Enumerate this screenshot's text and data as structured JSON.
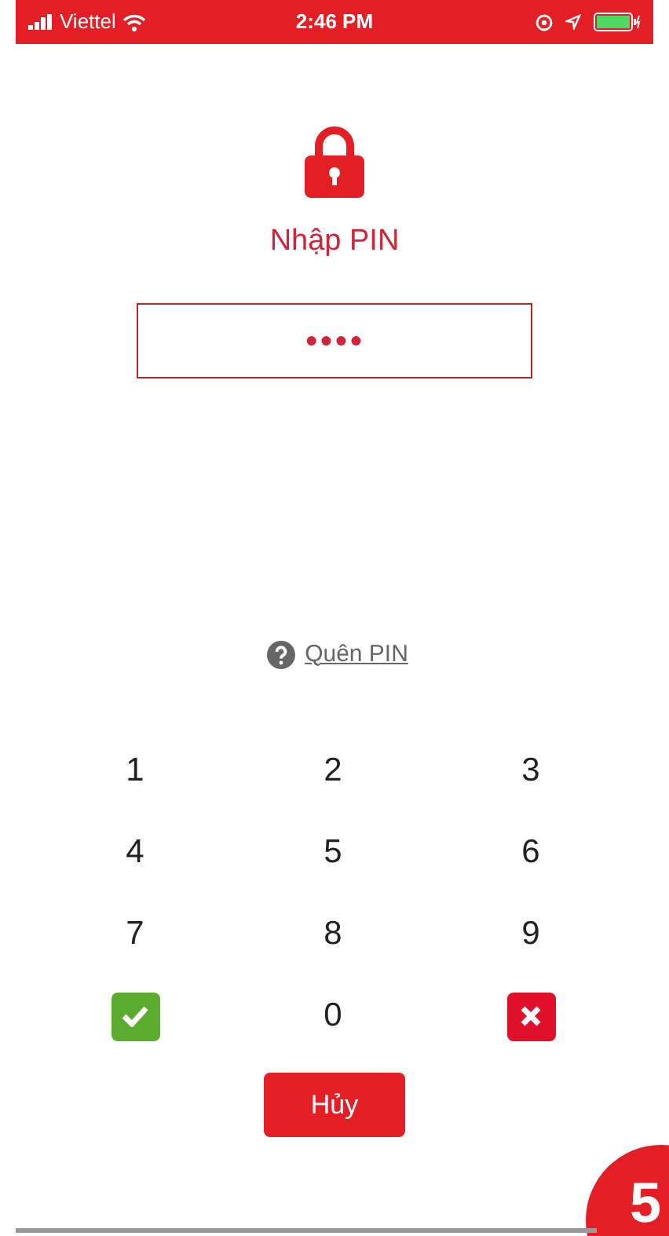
{
  "status_bar": {
    "carrier": "Viettel",
    "time": "2:46 PM"
  },
  "title": "Nhập PIN",
  "pin_field": {
    "value": "●●●●"
  },
  "forgot_link": "Quên PIN",
  "keypad": [
    {
      "kind": "digit",
      "label": "1"
    },
    {
      "kind": "digit",
      "label": "2"
    },
    {
      "kind": "digit",
      "label": "3"
    },
    {
      "kind": "digit",
      "label": "4"
    },
    {
      "kind": "digit",
      "label": "5"
    },
    {
      "kind": "digit",
      "label": "6"
    },
    {
      "kind": "digit",
      "label": "7"
    },
    {
      "kind": "digit",
      "label": "8"
    },
    {
      "kind": "digit",
      "label": "9"
    },
    {
      "kind": "confirm"
    },
    {
      "kind": "digit",
      "label": "0"
    },
    {
      "kind": "delete"
    }
  ],
  "cancel_button": "Hủy",
  "step_badge": "5"
}
